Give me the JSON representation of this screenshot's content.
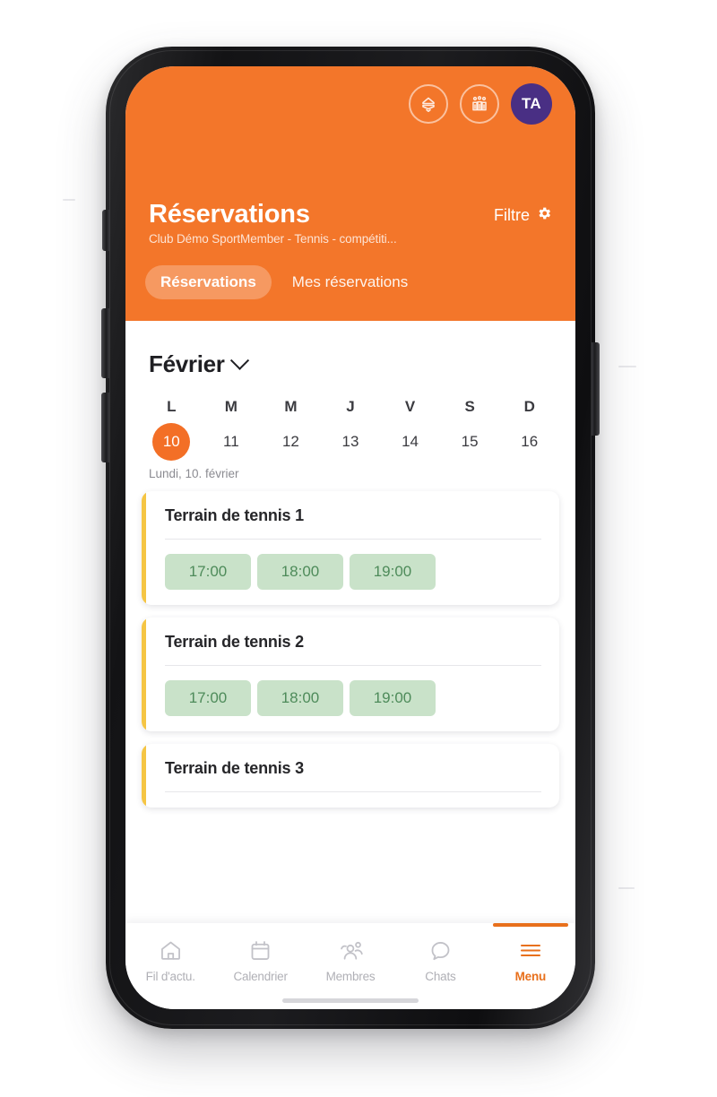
{
  "app": {
    "accent_orange": "#f3762a",
    "accent_orange_dark": "#e8701c",
    "avatar_purple": "#492f84",
    "card_stripe_yellow": "#f5c544",
    "slot_green_bg": "#c9e2c9",
    "slot_green_text": "#4e8b5a"
  },
  "header": {
    "club_badge_icon": "club-badge-icon",
    "team_icon": "team-group-icon",
    "avatar_initials": "TA",
    "title": "Réservations",
    "subtitle": "Club Démo SportMember - Tennis - compétiti...",
    "filter_label": "Filtre",
    "filter_icon": "gear-icon",
    "tabs": [
      {
        "label": "Réservations",
        "active": true
      },
      {
        "label": "Mes réservations",
        "active": false
      }
    ]
  },
  "calendar": {
    "month": "Février",
    "month_chevron_icon": "chevron-down-icon",
    "weekday_initials": [
      "L",
      "M",
      "M",
      "J",
      "V",
      "S",
      "D"
    ],
    "dates": [
      {
        "day": "10",
        "selected": true
      },
      {
        "day": "11",
        "selected": false
      },
      {
        "day": "12",
        "selected": false
      },
      {
        "day": "13",
        "selected": false
      },
      {
        "day": "14",
        "selected": false
      },
      {
        "day": "15",
        "selected": false
      },
      {
        "day": "16",
        "selected": false
      }
    ],
    "selected_day_label": "Lundi, 10. février"
  },
  "courts": [
    {
      "name": "Terrain de tennis 1",
      "slots": [
        "17:00",
        "18:00",
        "19:00"
      ]
    },
    {
      "name": "Terrain de tennis 2",
      "slots": [
        "17:00",
        "18:00",
        "19:00"
      ]
    },
    {
      "name": "Terrain de tennis 3",
      "slots": []
    }
  ],
  "bottom_nav": [
    {
      "label": "Fil d'actu.",
      "icon": "home-icon",
      "active": false
    },
    {
      "label": "Calendrier",
      "icon": "calendar-icon",
      "active": false
    },
    {
      "label": "Membres",
      "icon": "members-icon",
      "active": false
    },
    {
      "label": "Chats",
      "icon": "chat-bubble-icon",
      "active": false
    },
    {
      "label": "Menu",
      "icon": "hamburger-icon",
      "active": true
    }
  ]
}
